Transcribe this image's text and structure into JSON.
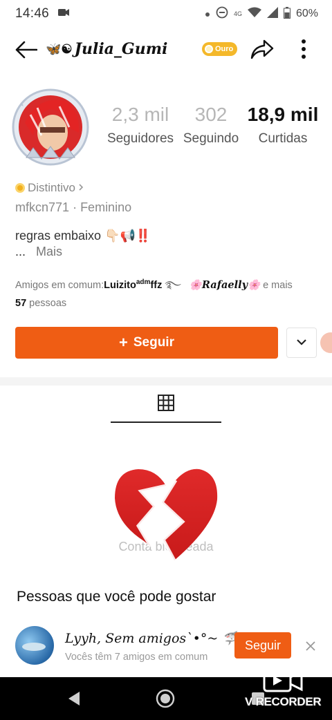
{
  "status_bar": {
    "time": "14:46",
    "network": "4G",
    "battery": "60%"
  },
  "header": {
    "title": "Julia_Gumi",
    "title_deco": "🦋☯",
    "badge": "Ouro",
    "icons": [
      "back-arrow-icon",
      "share-icon",
      "more-vertical-icon"
    ]
  },
  "profile": {
    "stats": [
      {
        "value": "2,3 mil",
        "label": "Seguidores"
      },
      {
        "value": "302",
        "label": "Seguindo"
      },
      {
        "value": "18,9 mil",
        "label": "Curtidas"
      }
    ],
    "badge_label": "Distintivo",
    "handle": "mfkcn771",
    "gender": "Feminino",
    "bio_line": "regras embaixo 👇🏻📢‼️",
    "bio_more_prefix": "...",
    "bio_more": "Mais",
    "mutual_prefix": "Amigos em comum:",
    "mutual_friend_1": "Luizito",
    "mutual_friend_1_sup": "adm",
    "mutual_friend_1_tail": "ffz",
    "mutual_friend_2": "🌸Rafaelly🌸",
    "mutual_suffix": "e mais",
    "mutual_count": "57",
    "mutual_count_unit": "pessoas",
    "follow_label": "Seguir",
    "follow_icon": "+"
  },
  "content": {
    "tab_icon": "grid-icon",
    "empty_text": "Conta bloqueada"
  },
  "suggestions": {
    "title": "Pessoas que você pode gostar",
    "items": [
      {
        "name": "Lyyh, Sem amigos`•°~ 🦈",
        "subtitle": "Vocês têm 7 amigos em comum",
        "follow_label": "Seguir"
      }
    ]
  },
  "overlay": {
    "recorder_label": "V RECORDER"
  },
  "colors": {
    "accent": "#ef5d14",
    "badge_gold": "#f4b82a",
    "stat_muted": "#b6b6b6"
  }
}
